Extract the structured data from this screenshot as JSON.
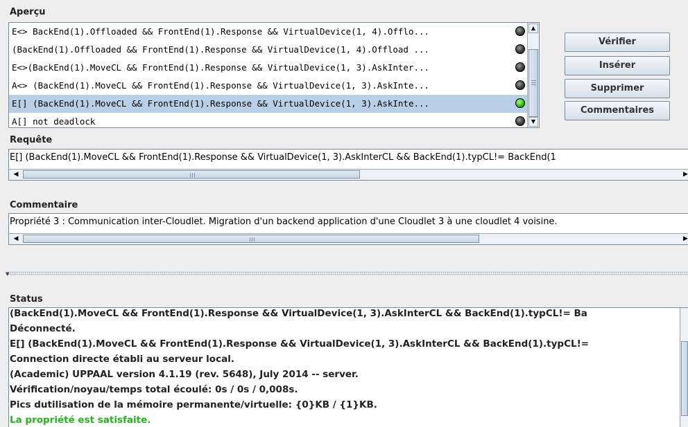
{
  "overview": {
    "title": "Aperçu",
    "rows": [
      {
        "text": "E<> BackEnd(1).Offloaded && FrontEnd(1).Response && VirtualDevice(1, 4).Offlo...",
        "status": "gray",
        "selected": false
      },
      {
        "text": "(BackEnd(1).Offloaded && FrontEnd(1).Response && VirtualDevice(1, 4).Offload ...",
        "status": "gray",
        "selected": false
      },
      {
        "text": "E<>(BackEnd(1).MoveCL && FrontEnd(1).Response && VirtualDevice(1, 3).AskInter...",
        "status": "gray",
        "selected": false
      },
      {
        "text": "A<> (BackEnd(1).MoveCL && FrontEnd(1).Response && VirtualDevice(1, 3).AskInte...",
        "status": "gray",
        "selected": false
      },
      {
        "text": "E[] (BackEnd(1).MoveCL && FrontEnd(1).Response && VirtualDevice(1, 3).AskInte...",
        "status": "green",
        "selected": true
      },
      {
        "text": "A[] not deadlock",
        "status": "gray",
        "selected": false
      }
    ]
  },
  "buttons": {
    "verify": "Vérifier",
    "insert": "Insérer",
    "delete": "Supprimer",
    "comments": "Commentaires"
  },
  "query": {
    "title": "Requête",
    "value": "E[] (BackEnd(1).MoveCL && FrontEnd(1).Response && VirtualDevice(1, 3).AskInterCL && BackEnd(1).typCL!= BackEnd(1"
  },
  "comment": {
    "title": "Commentaire",
    "value": "Propriété 3 : Communication inter-Cloudlet. Migration d'un backend application d'une Cloudlet 3 à une cloudlet 4 voisine."
  },
  "status": {
    "title": "Status",
    "lines": [
      "(BackEnd(1).MoveCL && FrontEnd(1).Response && VirtualDevice(1, 3).AskInterCL && BackEnd(1).typCL!= Ba",
      "Déconnecté.",
      "E[] (BackEnd(1).MoveCL && FrontEnd(1).Response && VirtualDevice(1, 3).AskInterCL && BackEnd(1).typCL!=",
      "Connection directe établi au serveur local.",
      "(Academic) UPPAAL version 4.1.19 (rev. 5648), July 2014 -- server.",
      "Vérification/noyau/temps total écoulé: 0s / 0s / 0,008s.",
      "Pics dutilisation de la mémoire permanente/virtuelle: {0}KB / {1}KB.",
      "La propriété est satisfaite."
    ],
    "success_color": "#22b81a"
  },
  "icons": {
    "dot_pending": "gray-circle-icon",
    "dot_satisfied": "green-circle-icon",
    "scroll_up": "▲",
    "scroll_down": "▼",
    "scroll_left": "◀",
    "scroll_right": "▶"
  }
}
